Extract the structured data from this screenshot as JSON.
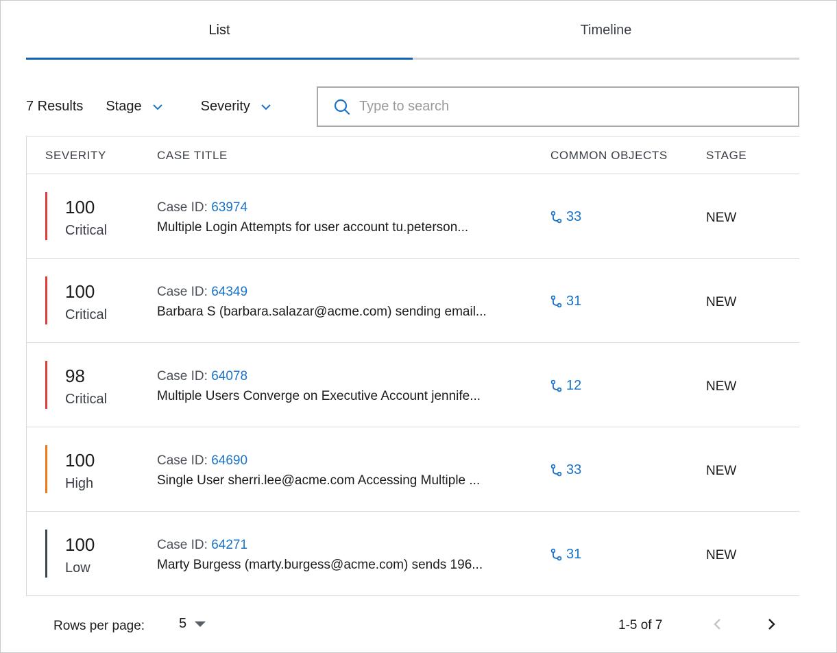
{
  "tabs": [
    {
      "label": "List",
      "active": true
    },
    {
      "label": "Timeline",
      "active": false
    }
  ],
  "filters": {
    "results": "7 Results",
    "stage_label": "Stage",
    "severity_label": "Severity",
    "search_placeholder": "Type to search"
  },
  "table": {
    "headers": {
      "severity": "SEVERITY",
      "case_title": "CASE TITLE",
      "common_objects": "COMMON OBJECTS",
      "stage": "STAGE"
    },
    "case_id_prefix": "Case ID: ",
    "rows": [
      {
        "severity_score": "100",
        "severity_label": "Critical",
        "severity_color": "#e03c3c",
        "case_id": "63974",
        "title": "Multiple Login Attempts for user account tu.peterson...",
        "objects": "33",
        "stage": "NEW"
      },
      {
        "severity_score": "100",
        "severity_label": "Critical",
        "severity_color": "#e03c3c",
        "case_id": "64349",
        "title": "Barbara S (barbara.salazar@acme.com) sending email...",
        "objects": "31",
        "stage": "NEW"
      },
      {
        "severity_score": "98",
        "severity_label": "Critical",
        "severity_color": "#e03c3c",
        "case_id": "64078",
        "title": "Multiple Users Converge on Executive Account jennife...",
        "objects": "12",
        "stage": "NEW"
      },
      {
        "severity_score": "100",
        "severity_label": "High",
        "severity_color": "#ec7a1c",
        "case_id": "64690",
        "title": "Single User sherri.lee@acme.com Accessing Multiple ...",
        "objects": "33",
        "stage": "NEW"
      },
      {
        "severity_score": "100",
        "severity_label": "Low",
        "severity_color": "#3d4550",
        "case_id": "64271",
        "title": "Marty Burgess (marty.burgess@acme.com) sends 196...",
        "objects": "31",
        "stage": "NEW"
      }
    ]
  },
  "pagination": {
    "rows_per_page_label": "Rows per page:",
    "rows_per_page_value": "5",
    "range": "1-5 of 7"
  },
  "icons": {
    "tab_underline_active": "#0b62b3",
    "link_color": "#1a73c8",
    "search": "search-icon",
    "dropdown": "chevron-down-icon",
    "objects": "branch-icon",
    "prev": "chevron-left-icon",
    "next": "chevron-right-icon"
  }
}
